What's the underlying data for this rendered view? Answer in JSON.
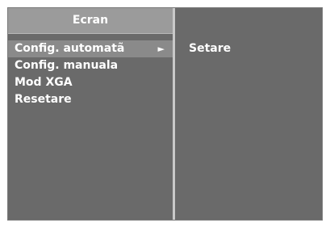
{
  "menu": {
    "title": "Ecran",
    "items": [
      {
        "label": "Config. automatã",
        "has_submenu": true,
        "selected": true
      },
      {
        "label": "Config. manuala",
        "has_submenu": false,
        "selected": false
      },
      {
        "label": "Mod XGA",
        "has_submenu": false,
        "selected": false
      },
      {
        "label": "Resetare",
        "has_submenu": false,
        "selected": false
      }
    ],
    "arrow_glyph": "►"
  },
  "submenu": {
    "items": [
      {
        "label": "Setare"
      }
    ]
  },
  "colors": {
    "panel_background": "#6a6a6a",
    "header_background": "#9b9b9b",
    "selected_background": "#8a8a8a",
    "divider": "#c9c9c9",
    "text": "#ffffff"
  },
  "icons": {
    "submenu_arrow": "right-triangle-arrow"
  }
}
